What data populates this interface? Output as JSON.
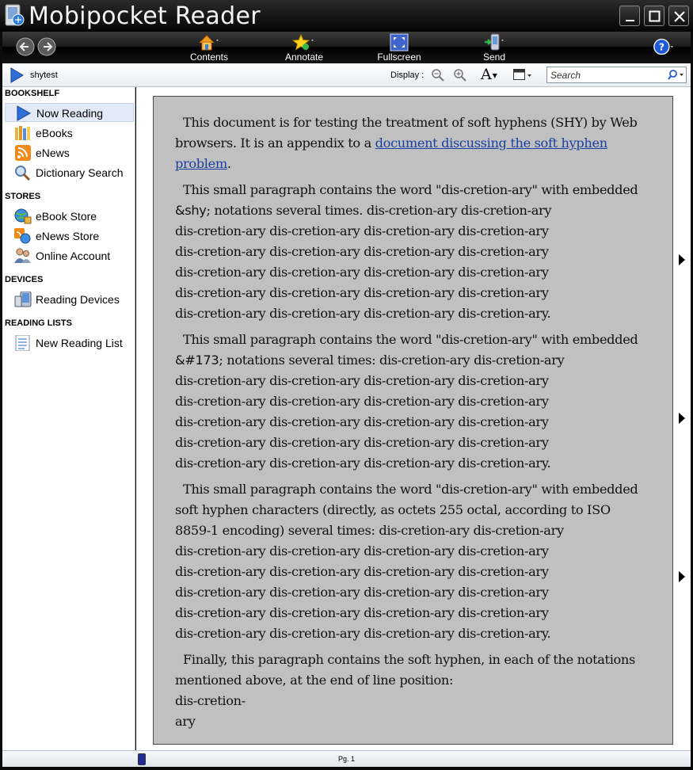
{
  "window": {
    "title": "Mobipocket Reader"
  },
  "toolbar": {
    "tools": [
      {
        "label": "Contents"
      },
      {
        "label": "Annotate"
      },
      {
        "label": "Fullscreen"
      },
      {
        "label": "Send"
      }
    ]
  },
  "subbar": {
    "document_name": "shytest",
    "display_label": "Display :",
    "font_button": "A",
    "search_placeholder": "Search"
  },
  "sidebar": {
    "sections": [
      {
        "title": "BOOKSHELF",
        "items": [
          "Now Reading",
          "eBooks",
          "eNews",
          "Dictionary Search"
        ]
      },
      {
        "title": "STORES",
        "items": [
          "eBook Store",
          "eNews Store",
          "Online Account"
        ]
      },
      {
        "title": "DEVICES",
        "items": [
          "Reading Devices"
        ]
      },
      {
        "title": "READING LISTS",
        "items": [
          "New Reading List"
        ]
      }
    ],
    "active_item": "Now Reading"
  },
  "document": {
    "p1": {
      "line1": "This document is for testing the treatment of soft hyphens (SHY) by Web",
      "line2_pre": "browsers. It is an appendix to a ",
      "link_part1": "document discussing the soft hyphen",
      "link_part2": "problem",
      "line3_post": "."
    },
    "p2": {
      "line1": "This small paragraph contains the word \"dis-cretion-ary\" with embedded",
      "line2_code": "&shy",
      "line2_rest": "; notations several times. dis-cretion-ary dis-cretion-ary",
      "repeat_line": "dis-cretion-ary dis-cretion-ary dis-cretion-ary dis-cretion-ary",
      "last_line": "dis-cretion-ary dis-cretion-ary dis-cretion-ary dis-cretion-ary."
    },
    "p3": {
      "line1": "This small paragraph contains the word \"dis-cretion-ary\" with embedded",
      "line2_code": "&#173",
      "line2_rest": "; notations several times: dis-cretion-ary dis-cretion-ary",
      "repeat_line": "dis-cretion-ary dis-cretion-ary dis-cretion-ary dis-cretion-ary",
      "last_line": "dis-cretion-ary dis-cretion-ary dis-cretion-ary dis-cretion-ary."
    },
    "p4": {
      "line1": "This small paragraph contains the word \"dis-cretion-ary\" with embedded",
      "line2": "soft hyphen characters (directly, as octets 255 octal, according to ISO",
      "line3": "8859-1 encoding) several times: dis-cretion-ary dis-cretion-ary",
      "repeat_line": "dis-cretion-ary dis-cretion-ary dis-cretion-ary dis-cretion-ary",
      "last_line": "dis-cretion-ary dis-cretion-ary dis-cretion-ary dis-cretion-ary."
    },
    "p5": {
      "line1": "Finally, this paragraph contains the soft hyphen, in each of the notations",
      "line2": "mentioned above, at the end of line position:",
      "line3": "dis-cretion-",
      "line4": "ary"
    }
  },
  "status": {
    "page": "Pg. 1"
  },
  "colors": {
    "page_background": "#c0c0c0",
    "link": "#1a3fa3",
    "toolbar": "#1c1c1c"
  }
}
